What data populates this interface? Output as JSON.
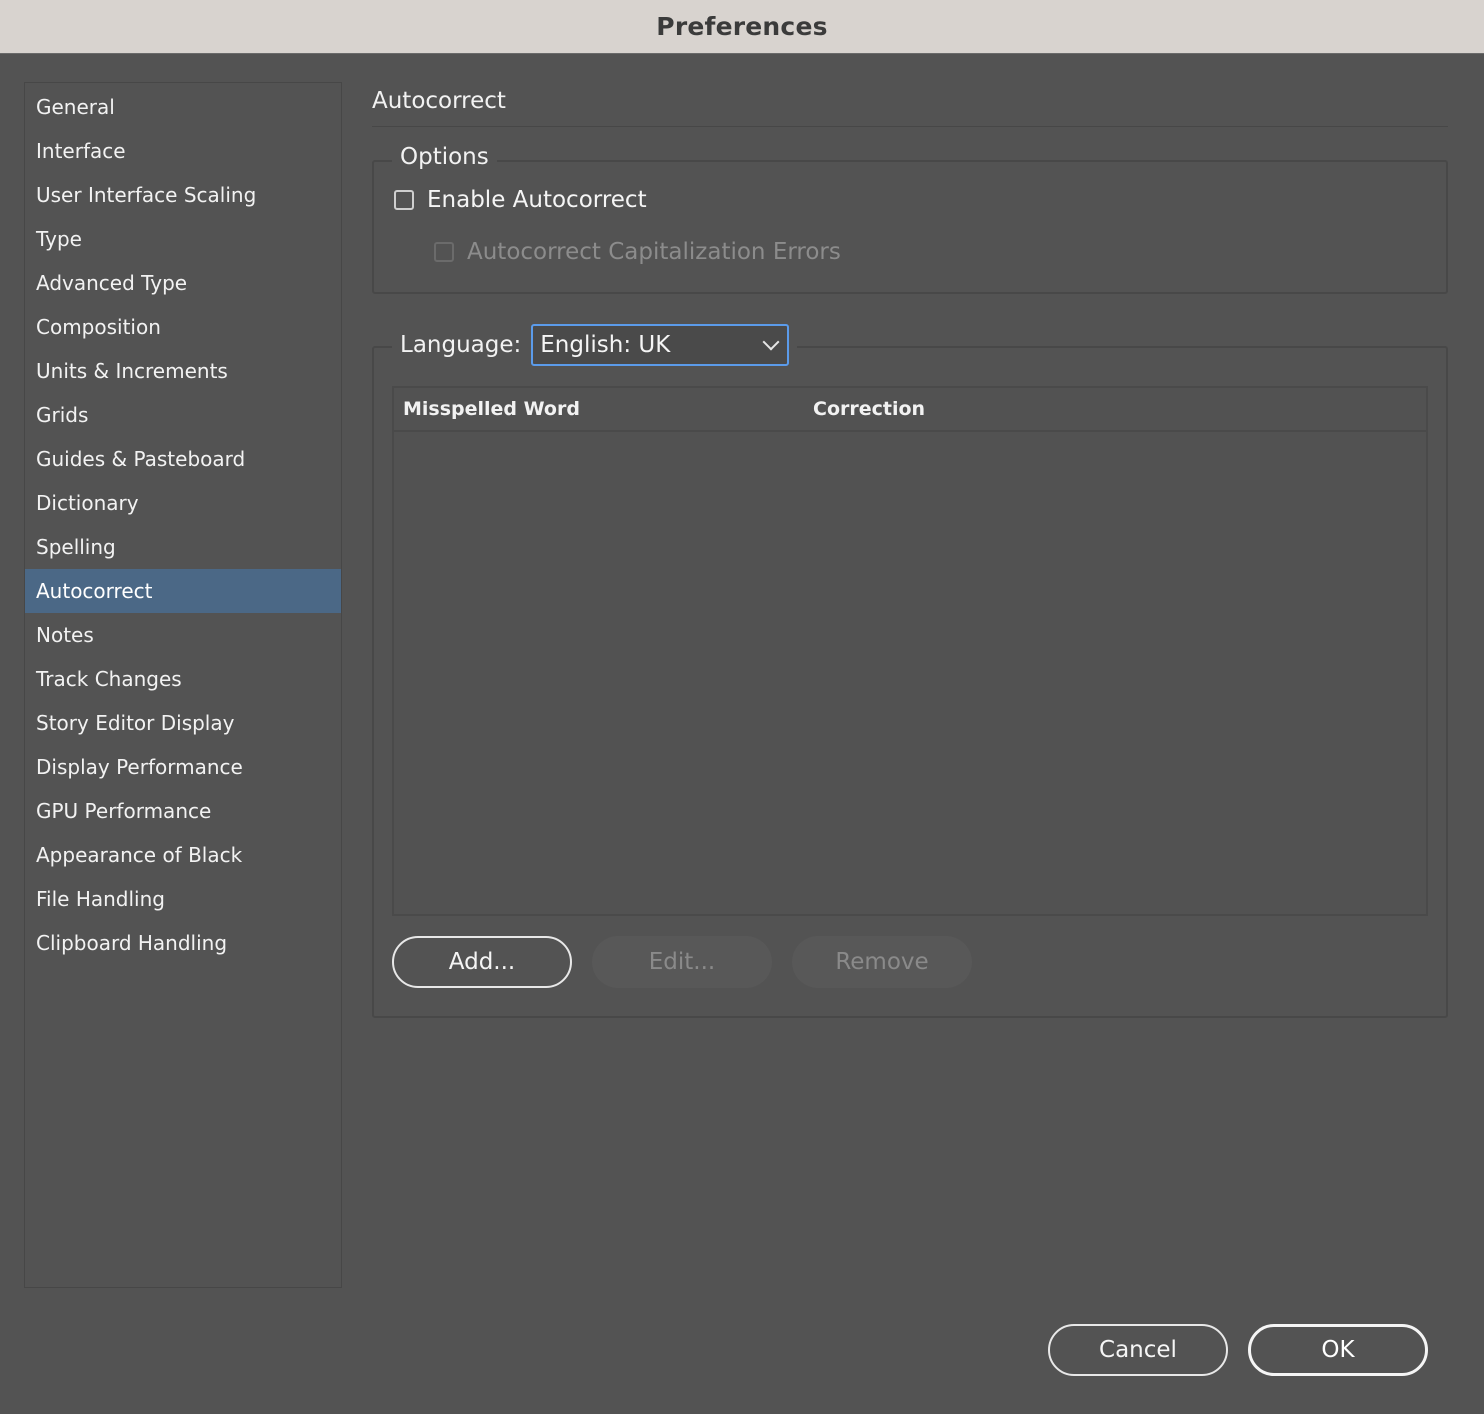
{
  "window": {
    "title": "Preferences"
  },
  "sidebar": {
    "items": [
      {
        "label": "General"
      },
      {
        "label": "Interface"
      },
      {
        "label": "User Interface Scaling"
      },
      {
        "label": "Type"
      },
      {
        "label": "Advanced Type"
      },
      {
        "label": "Composition"
      },
      {
        "label": "Units & Increments"
      },
      {
        "label": "Grids"
      },
      {
        "label": "Guides & Pasteboard"
      },
      {
        "label": "Dictionary"
      },
      {
        "label": "Spelling"
      },
      {
        "label": "Autocorrect",
        "selected": true
      },
      {
        "label": "Notes"
      },
      {
        "label": "Track Changes"
      },
      {
        "label": "Story Editor Display"
      },
      {
        "label": "Display Performance"
      },
      {
        "label": "GPU Performance"
      },
      {
        "label": "Appearance of Black"
      },
      {
        "label": "File Handling"
      },
      {
        "label": "Clipboard Handling"
      }
    ]
  },
  "main": {
    "section_title": "Autocorrect",
    "options": {
      "legend": "Options",
      "enable_autocorrect": {
        "label": "Enable Autocorrect",
        "checked": false
      },
      "capitalization_errors": {
        "label": "Autocorrect Capitalization Errors",
        "checked": false,
        "disabled": true
      }
    },
    "language": {
      "label": "Language:",
      "selected": "English: UK"
    },
    "table": {
      "columns": [
        "Misspelled Word",
        "Correction"
      ],
      "rows": []
    },
    "buttons": {
      "add": "Add...",
      "edit": "Edit...",
      "remove": "Remove"
    }
  },
  "footer": {
    "cancel": "Cancel",
    "ok": "OK"
  },
  "colors": {
    "background": "#535353",
    "titlebar": "#d8d3cf",
    "selection": "#4b6886",
    "focus_ring": "#5b9bea"
  }
}
